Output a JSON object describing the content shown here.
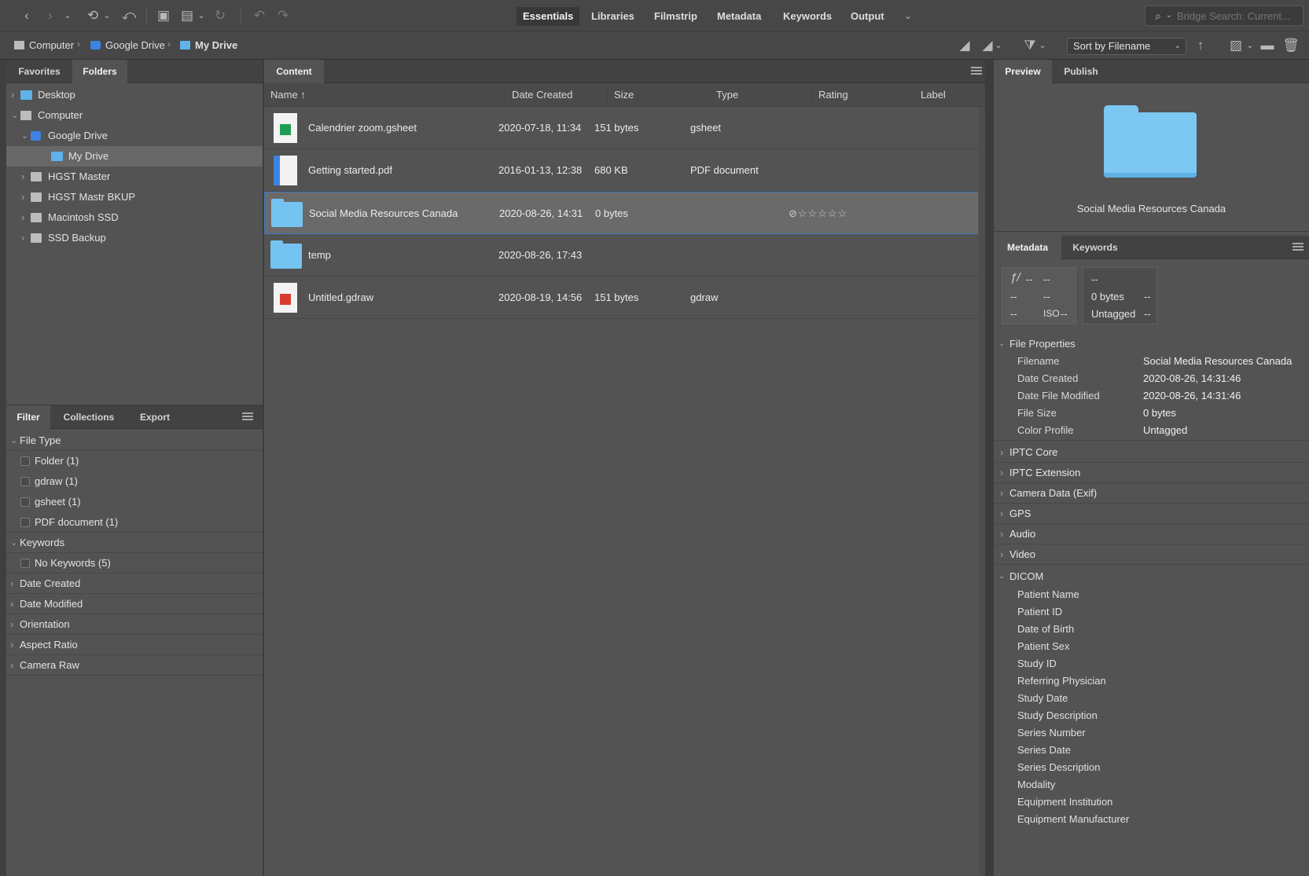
{
  "toolbar": {
    "workspaces": [
      "Essentials",
      "Libraries",
      "Filmstrip",
      "Metadata",
      "Keywords",
      "Output"
    ],
    "active_workspace": "Essentials",
    "search_placeholder": "Bridge Search: Current..."
  },
  "path": {
    "crumbs": [
      "Computer",
      "Google Drive",
      "My Drive"
    ],
    "sort_label": "Sort by Filename"
  },
  "left": {
    "tabs": [
      "Favorites",
      "Folders"
    ],
    "active_tab": "Folders",
    "tree": [
      {
        "label": "Desktop",
        "icon": "folder-icon",
        "expanded": false
      },
      {
        "label": "Computer",
        "icon": "drive-icon",
        "expanded": true
      },
      {
        "label": "Google Drive",
        "icon": "google-drive-icon",
        "expanded": true
      },
      {
        "label": "My Drive",
        "icon": "folder-icon",
        "selected": true
      },
      {
        "label": "HGST Master",
        "icon": "drive-icon",
        "expanded": false
      },
      {
        "label": "HGST Mastr BKUP",
        "icon": "drive-icon",
        "expanded": false
      },
      {
        "label": "Macintosh SSD",
        "icon": "drive-icon",
        "expanded": false
      },
      {
        "label": "SSD Backup",
        "icon": "drive-icon",
        "expanded": false
      }
    ],
    "filter_tabs": [
      "Filter",
      "Collections",
      "Export"
    ],
    "filter": {
      "file_type_label": "File Type",
      "file_types": [
        "Folder (1)",
        "gdraw (1)",
        "gsheet (1)",
        "PDF document (1)"
      ],
      "keywords_label": "Keywords",
      "keywords": [
        "No Keywords (5)"
      ],
      "collapsed": [
        "Date Created",
        "Date Modified",
        "Orientation",
        "Aspect Ratio",
        "Camera Raw"
      ]
    }
  },
  "content": {
    "tab": "Content",
    "columns": [
      "Name ↑",
      "Date Created",
      "Size",
      "Type",
      "Rating",
      "Label"
    ],
    "rows": [
      {
        "name": "Calendrier zoom.gsheet",
        "date": "2020-07-18, 11:34",
        "size": "151 bytes",
        "type": "gsheet",
        "rating": "",
        "thumb": "gsheet-icon"
      },
      {
        "name": "Getting started.pdf",
        "date": "2016-01-13, 12:38",
        "size": "680 KB",
        "type": "PDF document",
        "rating": "",
        "thumb": "pdf-icon"
      },
      {
        "name": "Social Media Resources Canada",
        "date": "2020-08-26, 14:31",
        "size": "0 bytes",
        "type": "",
        "rating": "⊘☆☆☆☆☆",
        "thumb": "folder-icon",
        "selected": true
      },
      {
        "name": "temp",
        "date": "2020-08-26, 17:43",
        "size": "",
        "type": "",
        "rating": "",
        "thumb": "folder-icon"
      },
      {
        "name": "Untitled.gdraw",
        "date": "2020-08-19, 14:56",
        "size": "151 bytes",
        "type": "gdraw",
        "rating": "",
        "thumb": "gdraw-icon"
      }
    ]
  },
  "right": {
    "preview_tabs": [
      "Preview",
      "Publish"
    ],
    "preview_caption": "Social Media Resources Canada",
    "meta_tabs": [
      "Metadata",
      "Keywords"
    ],
    "camera_box": {
      "aperture": "--",
      "shutter": "--",
      "r2a": "--",
      "r2b": "--",
      "r3a": "--",
      "iso": "--",
      "top": "--",
      "size": "0 bytes",
      "size_b": "--",
      "profile": "Untagged",
      "profile_b": "--"
    },
    "file_properties_label": "File Properties",
    "file_properties": [
      {
        "k": "Filename",
        "v": "Social Media Resources Canada"
      },
      {
        "k": "Date Created",
        "v": "2020-08-26, 14:31:46"
      },
      {
        "k": "Date File Modified",
        "v": "2020-08-26, 14:31:46"
      },
      {
        "k": "File Size",
        "v": "0 bytes"
      },
      {
        "k": "Color Profile",
        "v": "Untagged"
      }
    ],
    "sections": [
      "IPTC Core",
      "IPTC Extension",
      "Camera Data (Exif)",
      "GPS",
      "Audio",
      "Video"
    ],
    "dicom_label": "DICOM",
    "dicom": [
      "Patient Name",
      "Patient ID",
      "Date of Birth",
      "Patient Sex",
      "Study ID",
      "Referring Physician",
      "Study Date",
      "Study Description",
      "Series Number",
      "Series Date",
      "Series Description",
      "Modality",
      "Equipment Institution",
      "Equipment Manufacturer"
    ]
  }
}
